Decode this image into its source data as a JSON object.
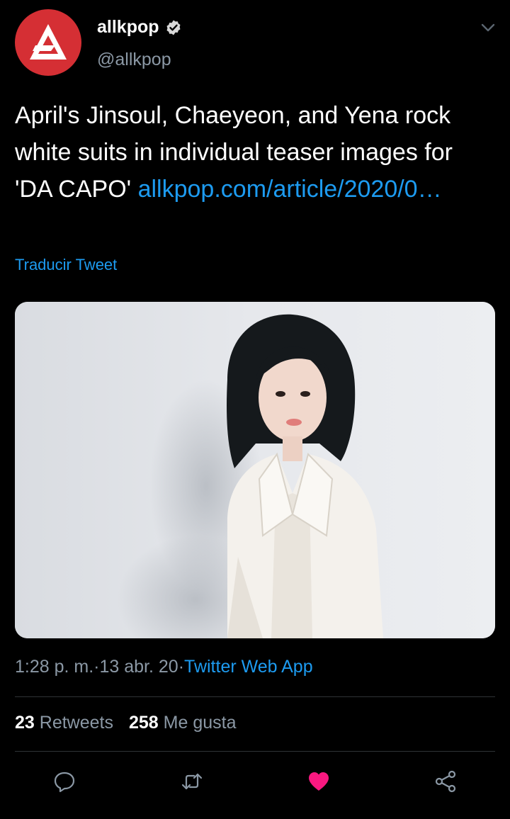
{
  "header": {
    "display_name": "allkpop",
    "handle": "@allkpop"
  },
  "tweet": {
    "text": "April's Jinsoul, Chaeyeon, and Yena rock white suits in individual teaser images for 'DA CAPO'",
    "link_text": "allkpop.com/article/2020/0…",
    "translate_label": "Traducir Tweet"
  },
  "meta": {
    "time": "1:28 p. m.",
    "separator1": " · ",
    "date": "13 abr. 20",
    "separator2": " · ",
    "source": "Twitter Web App"
  },
  "stats": {
    "retweets_count": "23",
    "retweets_label": "Retweets",
    "likes_count": "258",
    "likes_label": "Me gusta"
  },
  "colors": {
    "background": "#000000",
    "accent": "#1d9bf0",
    "like": "#f91880",
    "avatar": "#d52f34",
    "muted": "#8b98a5"
  },
  "icons": {
    "reply": "reply-icon",
    "retweet": "retweet-icon",
    "like": "heart-filled-icon",
    "share": "share-icon",
    "more": "chevron-down-icon",
    "verified": "verified-badge-icon"
  }
}
